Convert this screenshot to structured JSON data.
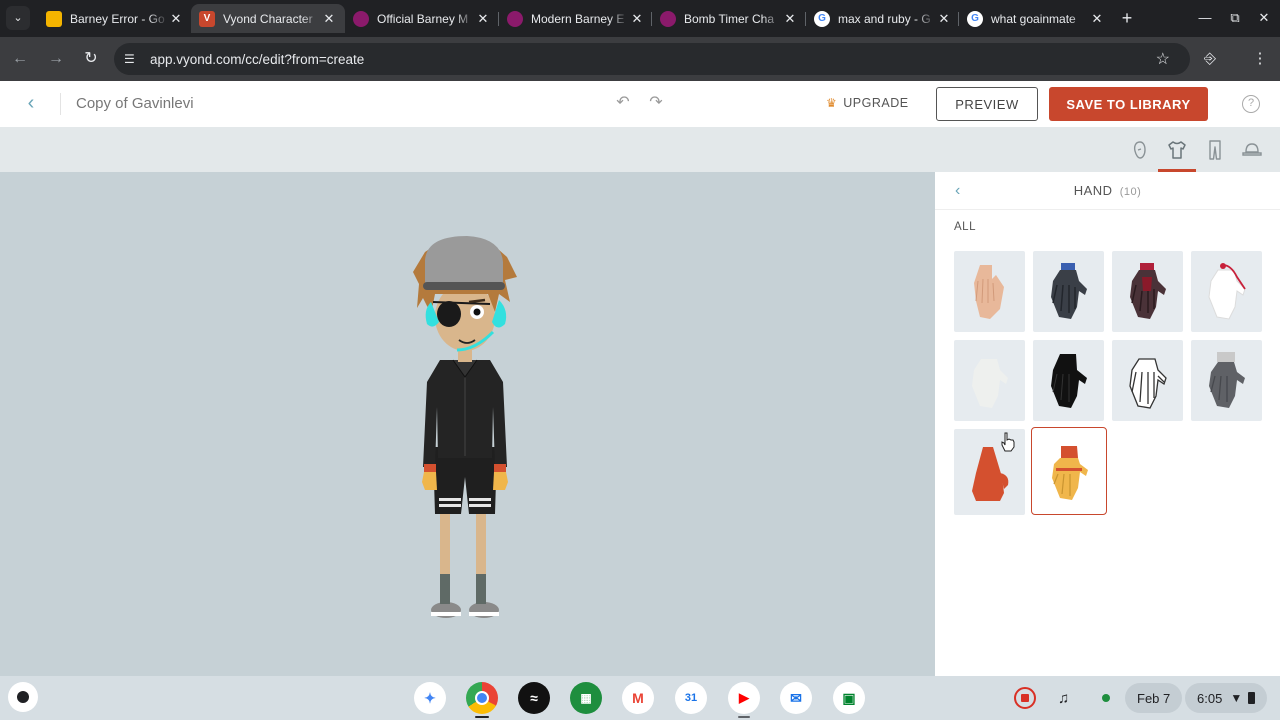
{
  "browser": {
    "tabs": [
      {
        "title": "Barney Error - Go",
        "favicon": "slides",
        "color": "#f4b400",
        "active": false
      },
      {
        "title": "Vyond Character",
        "favicon": "V",
        "color": "#c8472d",
        "active": true
      },
      {
        "title": "Official Barney M",
        "favicon": "vyond-video",
        "color": "#8b1a6b",
        "active": false
      },
      {
        "title": "Modern Barney E",
        "favicon": "vyond-video",
        "color": "#8b1a6b",
        "active": false
      },
      {
        "title": "Bomb Timer Cha",
        "favicon": "vyond-video",
        "color": "#8b1a6b",
        "active": false
      },
      {
        "title": "max and ruby - G",
        "favicon": "google",
        "color": "#ffffff",
        "active": false
      },
      {
        "title": "what goainmate",
        "favicon": "google",
        "color": "#ffffff",
        "active": false
      }
    ],
    "url": "app.vyond.com/cc/edit?from=create"
  },
  "editor": {
    "title": "Copy of Gavinlevi",
    "upgrade_label": "UPGRADE",
    "preview_label": "PREVIEW",
    "save_label": "SAVE TO LIBRARY",
    "help": "?"
  },
  "categories": [
    "head-icon",
    "shirt-icon",
    "pants-icon",
    "hat-icon"
  ],
  "panel": {
    "title": "HAND",
    "count": "(10)",
    "filter_label": "ALL",
    "items": [
      {
        "name": "bare-hand",
        "fill": "#e8b89a",
        "cuff": "#e8b89a",
        "selected": false
      },
      {
        "name": "dark-glove-blue-cuff",
        "fill": "#3a3f47",
        "cuff": "#3a5fb0",
        "selected": false
      },
      {
        "name": "dark-red-glove",
        "fill": "#4a3238",
        "cuff": "#b0203a",
        "selected": false
      },
      {
        "name": "white-glove-red-trim",
        "fill": "#ffffff",
        "cuff": "#c8203a",
        "selected": false
      },
      {
        "name": "faint-white-glove",
        "fill": "#eef0ee",
        "cuff": "#e6ebef",
        "selected": false
      },
      {
        "name": "black-glove",
        "fill": "#111111",
        "cuff": "#111111",
        "selected": false
      },
      {
        "name": "skeleton-hand",
        "fill": "#ffffff",
        "cuff": "#ffffff",
        "selected": false
      },
      {
        "name": "grey-glove",
        "fill": "#5f6166",
        "cuff": "#c9c9c9",
        "selected": false
      },
      {
        "name": "red-mitten",
        "fill": "#d4502f",
        "cuff": "#d4502f",
        "selected": false
      },
      {
        "name": "yellow-glove-red-cuff",
        "fill": "#f0b64b",
        "cuff": "#d4502f",
        "selected": true
      }
    ]
  },
  "shelf": {
    "apps": [
      "gemini",
      "chrome",
      "spotify",
      "sheets",
      "gmail",
      "calendar",
      "youtube",
      "messages",
      "meet"
    ],
    "date": "Feb 7",
    "time": "6:05"
  }
}
